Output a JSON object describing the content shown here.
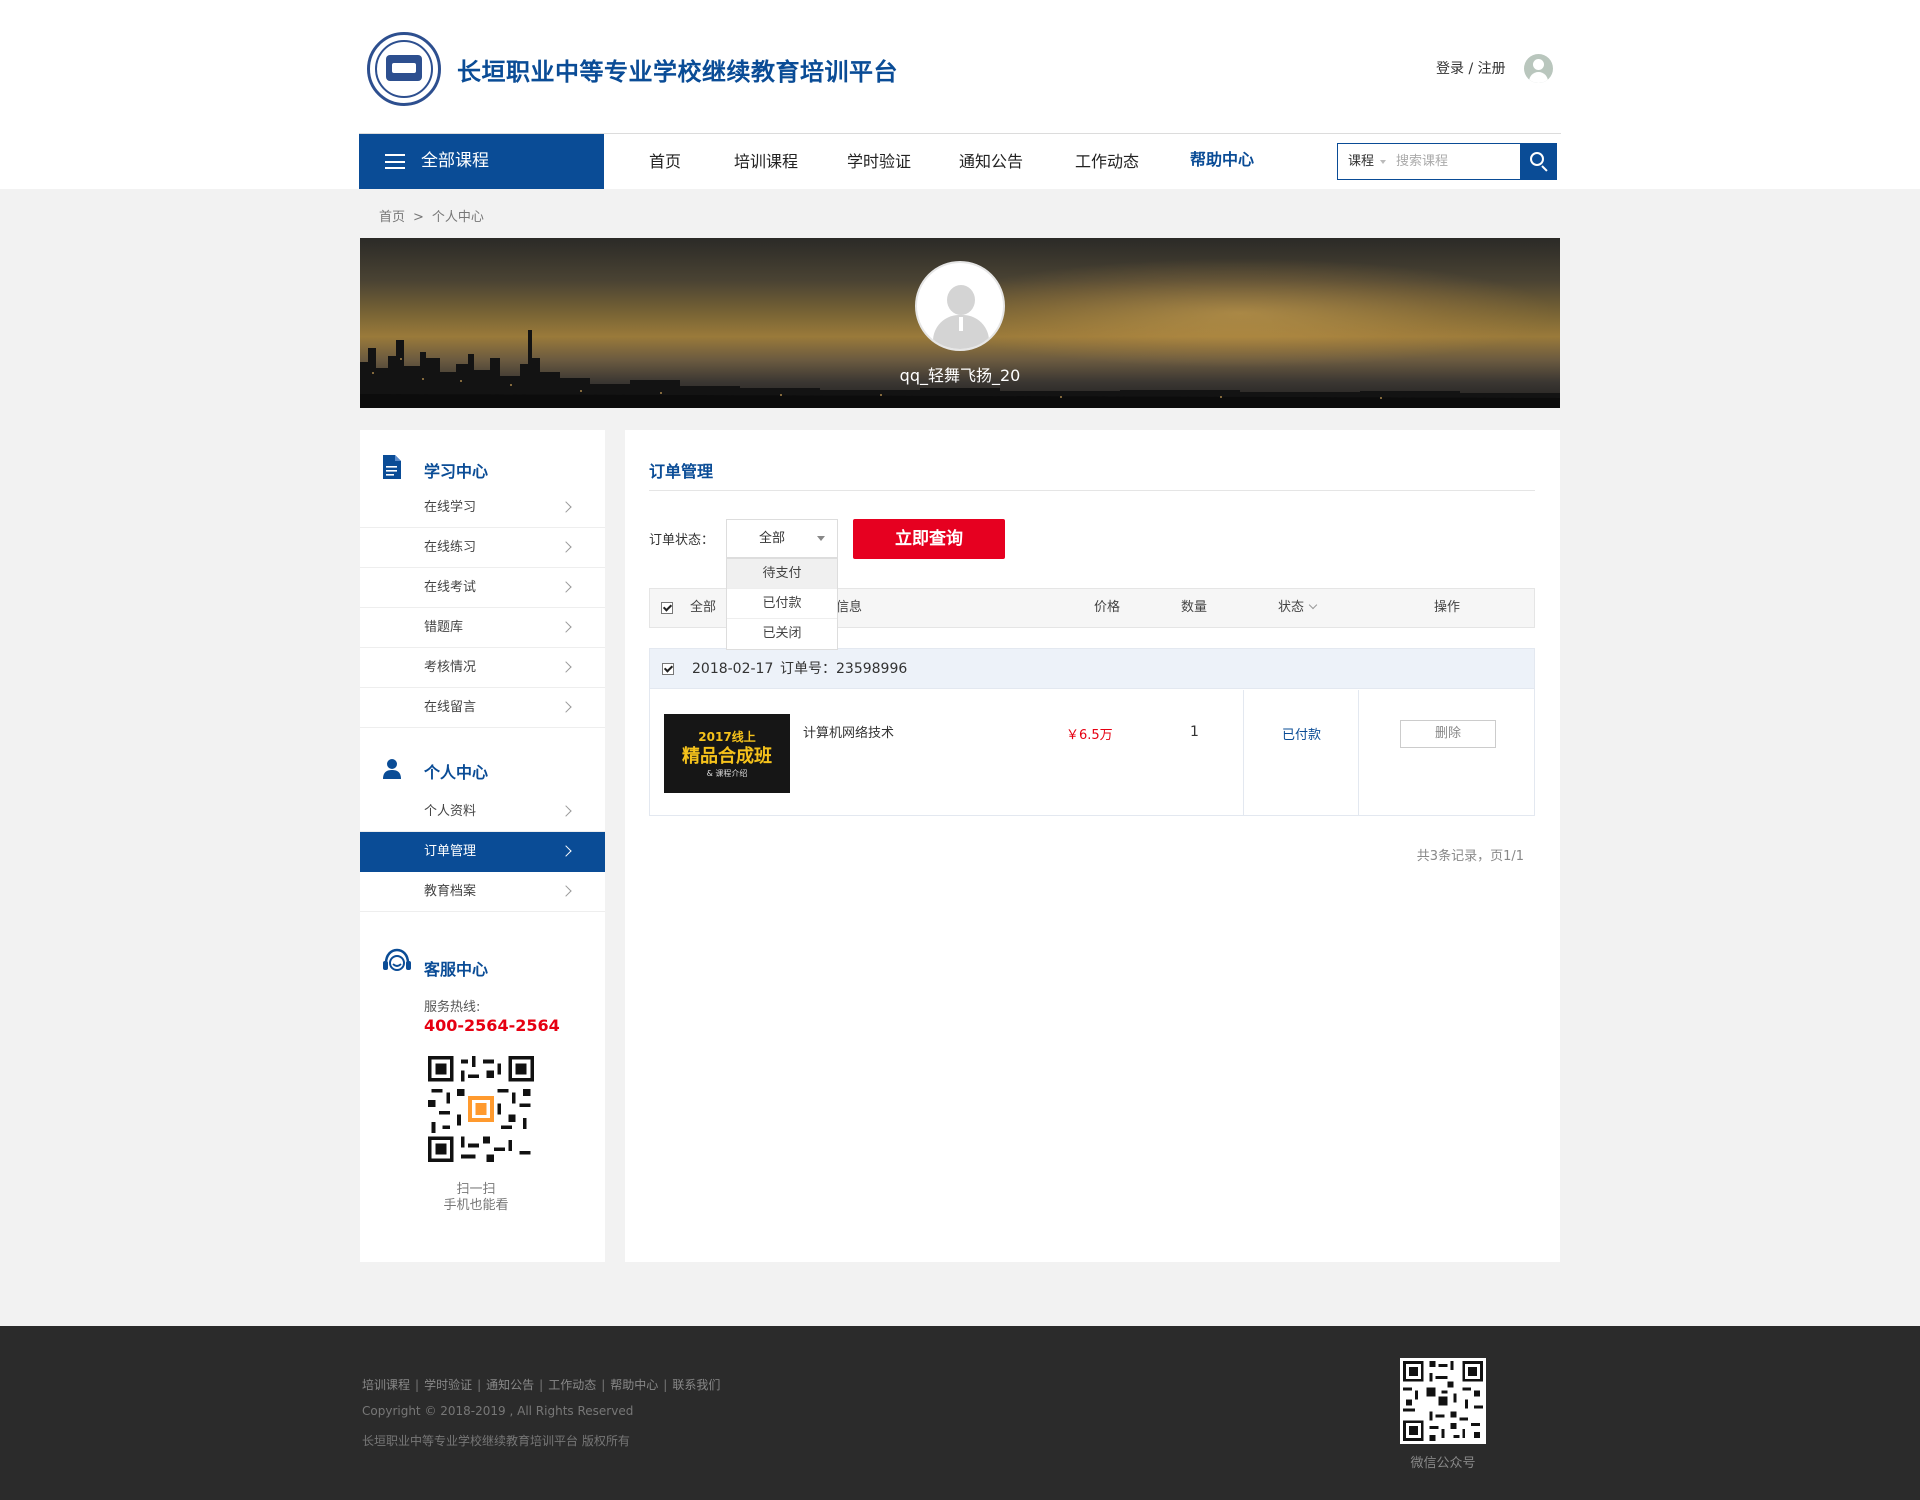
{
  "header": {
    "site_title": "长垣职业中等专业学校继续教育培训平台",
    "login": "登录",
    "register": "注册",
    "login_sep": " / "
  },
  "nav": {
    "all_courses": "全部课程",
    "links": [
      "首页",
      "培训课程",
      "学时验证",
      "通知公告",
      "工作动态",
      "帮助中心"
    ],
    "active": "帮助中心",
    "search_type": "课程",
    "search_placeholder": "搜索课程"
  },
  "breadcrumb": {
    "home": "首页",
    "sep": ">",
    "current": "个人中心"
  },
  "profile": {
    "username": "qq_轻舞飞扬_20"
  },
  "sidebar": {
    "study_center": {
      "title": "学习中心",
      "items": [
        "在线学习",
        "在线练习",
        "在线考试",
        "错题库",
        "考核情况",
        "在线留言"
      ]
    },
    "personal_center": {
      "title": "个人中心",
      "items": [
        "个人资料",
        "订单管理",
        "教育档案"
      ],
      "active": "订单管理"
    },
    "service_center": {
      "title": "客服中心",
      "hotline_label": "服务热线:",
      "hotline": "400-2564-2564",
      "scan_line1": "扫一扫",
      "scan_line2": "手机也能看"
    }
  },
  "main": {
    "title": "订单管理",
    "filter_label": "订单状态：",
    "status_selected": "全部",
    "status_options": [
      "待支付",
      "已付款",
      "已关闭"
    ],
    "query_button": "立即查询",
    "table_headers": {
      "all": "全部",
      "info_partial": "信息",
      "price": "价格",
      "quantity": "数量",
      "state": "状态",
      "action": "操作"
    },
    "orders": [
      {
        "date": "2018-02-17",
        "order_no_label": "订单号：",
        "order_no": "23598996",
        "thumb_line1": "2017线上",
        "thumb_line2": "精品合成班",
        "thumb_line3": "& 课程介绍",
        "course": "计算机网络技术",
        "price": "￥6.5万",
        "quantity": "1",
        "status": "已付款",
        "action": "删除"
      }
    ],
    "records": "共3条记录，页1/1"
  },
  "footer": {
    "links": [
      "培训课程",
      "学时验证",
      "通知公告",
      "工作动态",
      "帮助中心",
      "联系我们"
    ],
    "copyright": "Copyright © 2018-2019 , All Rights Reserved",
    "rights": "长垣职业中等专业学校继续教育培训平台 版权所有",
    "qr_label": "微信公众号"
  },
  "colors": {
    "brand_blue": "#0a4c96",
    "accent_red": "#e60020",
    "footer_bg": "#2b2b2b",
    "page_bg": "#f2f2f2"
  },
  "icons": [
    "school-logo",
    "user-avatar-icon",
    "menu-icon",
    "search-icon",
    "document-icon",
    "person-icon",
    "headset-icon",
    "chevron-right-icon",
    "qr-code"
  ]
}
